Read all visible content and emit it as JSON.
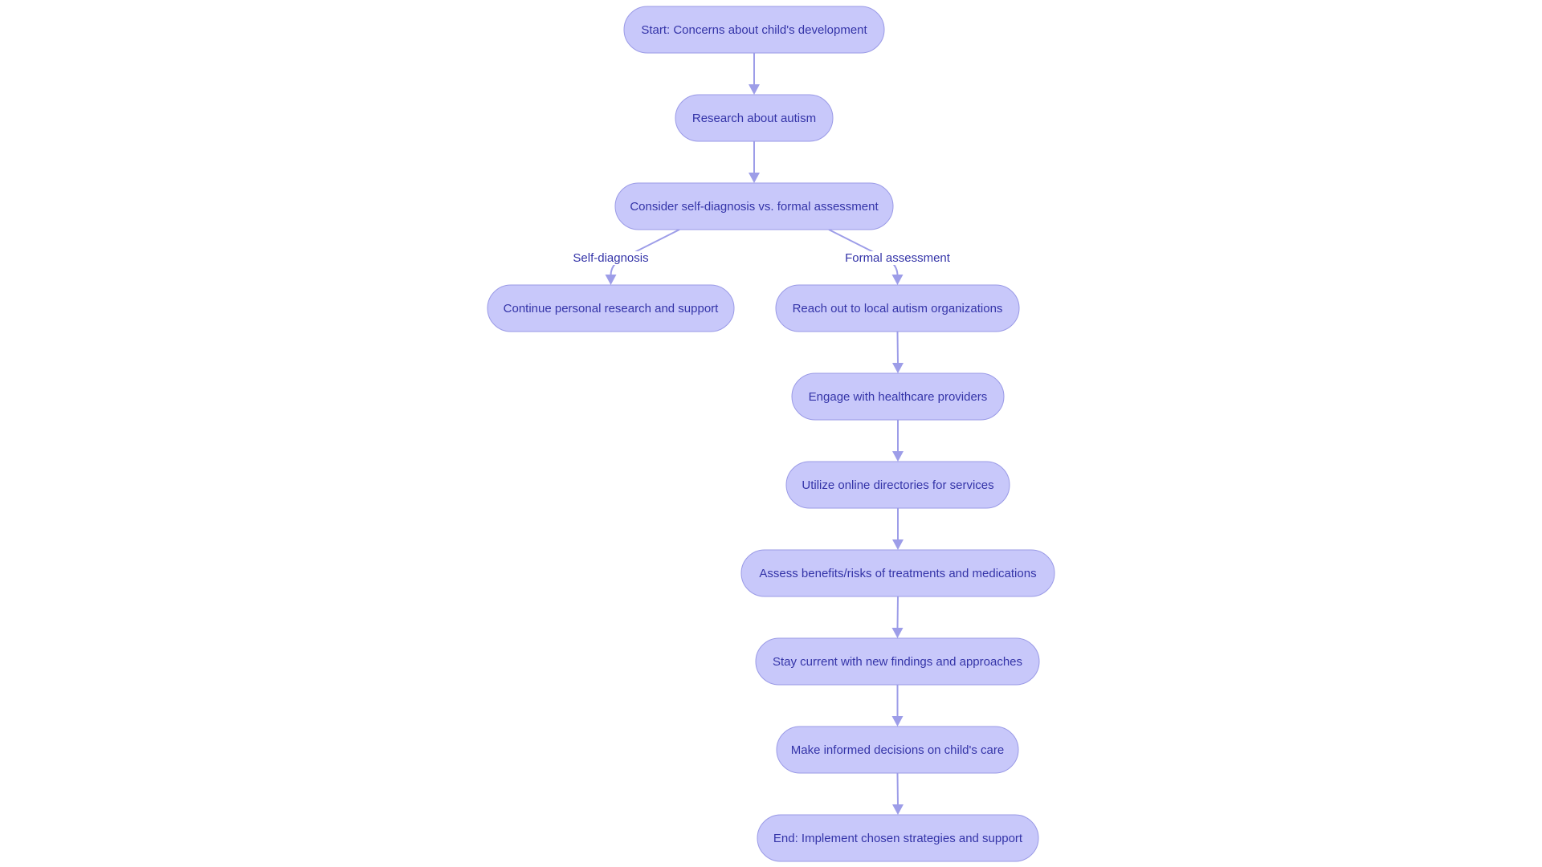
{
  "diagram": {
    "type": "flowchart",
    "direction": "top-down",
    "colors": {
      "node_fill": "#c8c8fa",
      "node_border": "#9a9ae6",
      "text": "#3434a8",
      "edge": "#9d9de8",
      "background": "#ffffff"
    },
    "nodes": [
      {
        "id": "start",
        "label": "Start: Concerns about child's development"
      },
      {
        "id": "research",
        "label": "Research about autism"
      },
      {
        "id": "consider",
        "label": "Consider self-diagnosis vs. formal assessment"
      },
      {
        "id": "continue",
        "label": "Continue personal research and support"
      },
      {
        "id": "reach",
        "label": "Reach out to local autism organizations"
      },
      {
        "id": "engage",
        "label": "Engage with healthcare providers"
      },
      {
        "id": "utilize",
        "label": "Utilize online directories for services"
      },
      {
        "id": "assess",
        "label": "Assess benefits/risks of treatments and medications"
      },
      {
        "id": "stay",
        "label": "Stay current with new findings and approaches"
      },
      {
        "id": "make",
        "label": "Make informed decisions on child's care"
      },
      {
        "id": "end",
        "label": "End: Implement chosen strategies and support"
      }
    ],
    "edges": [
      {
        "from": "start",
        "to": "research",
        "label": ""
      },
      {
        "from": "research",
        "to": "consider",
        "label": ""
      },
      {
        "from": "consider",
        "to": "continue",
        "label": "Self-diagnosis"
      },
      {
        "from": "consider",
        "to": "reach",
        "label": "Formal assessment"
      },
      {
        "from": "reach",
        "to": "engage",
        "label": ""
      },
      {
        "from": "engage",
        "to": "utilize",
        "label": ""
      },
      {
        "from": "utilize",
        "to": "assess",
        "label": ""
      },
      {
        "from": "assess",
        "to": "stay",
        "label": ""
      },
      {
        "from": "stay",
        "to": "make",
        "label": ""
      },
      {
        "from": "make",
        "to": "end",
        "label": ""
      }
    ]
  }
}
